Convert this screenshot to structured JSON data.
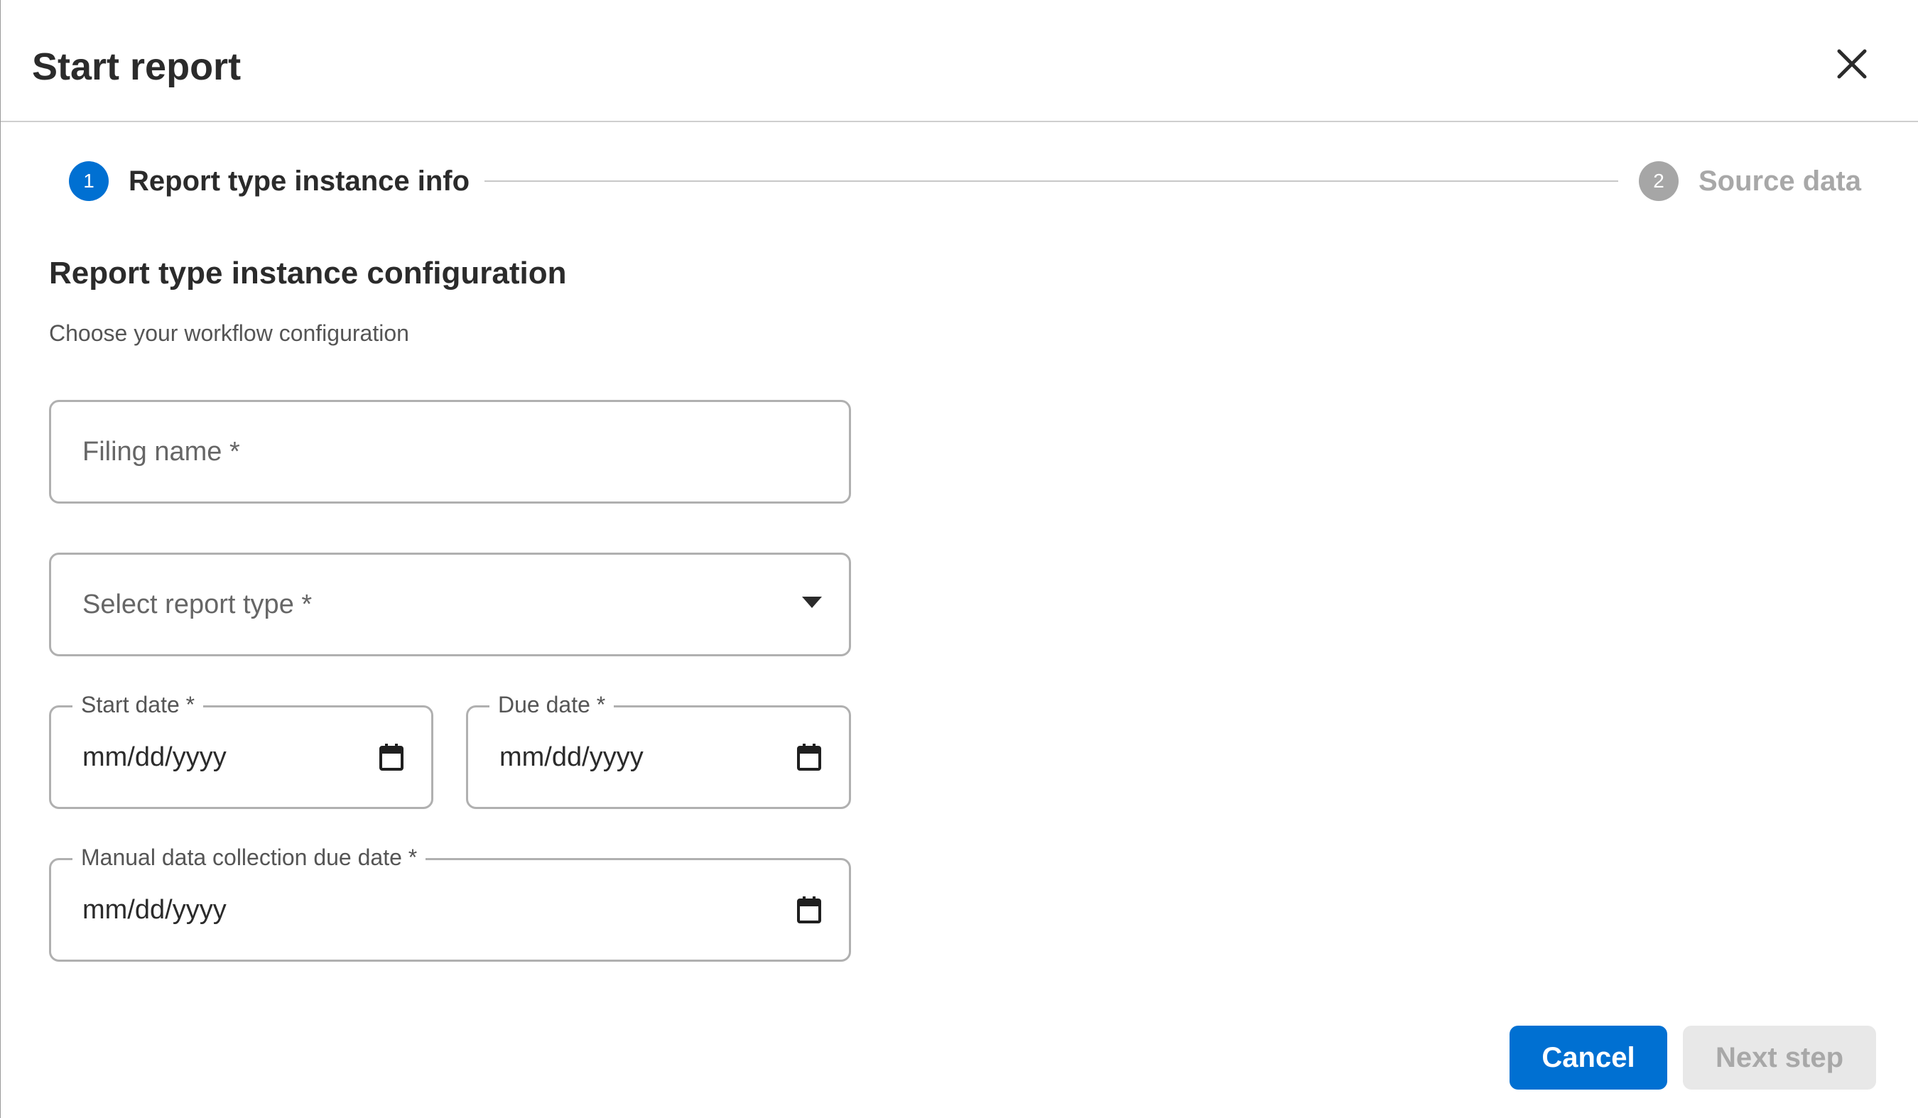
{
  "dialog": {
    "title": "Start report",
    "close_icon": "close-icon"
  },
  "stepper": {
    "steps": [
      {
        "number": "1",
        "label": "Report type instance info",
        "state": "active",
        "color": "#0070d2"
      },
      {
        "number": "2",
        "label": "Source data",
        "state": "inactive",
        "color": "#a6a6a6"
      }
    ]
  },
  "section": {
    "title": "Report type instance configuration",
    "subtitle": "Choose your workflow configuration"
  },
  "form": {
    "filing_name": {
      "placeholder": "Filing name *",
      "value": ""
    },
    "report_type": {
      "placeholder": "Select report type *",
      "value": "",
      "icon": "caret-down-icon"
    },
    "start_date": {
      "label": "Start date *",
      "value": "mm/dd/yyyy",
      "icon": "calendar-icon"
    },
    "due_date": {
      "label": "Due date *",
      "value": "mm/dd/yyyy",
      "icon": "calendar-icon"
    },
    "manual_due_date": {
      "label": "Manual data collection due date *",
      "value": "mm/dd/yyyy",
      "icon": "calendar-icon"
    }
  },
  "actions": {
    "cancel_label": "Cancel",
    "next_label": "Next step",
    "next_enabled": false
  },
  "colors": {
    "accent": "#0070d2",
    "disabled_bg": "#e8e8e8",
    "disabled_text": "#a8a8a8"
  }
}
